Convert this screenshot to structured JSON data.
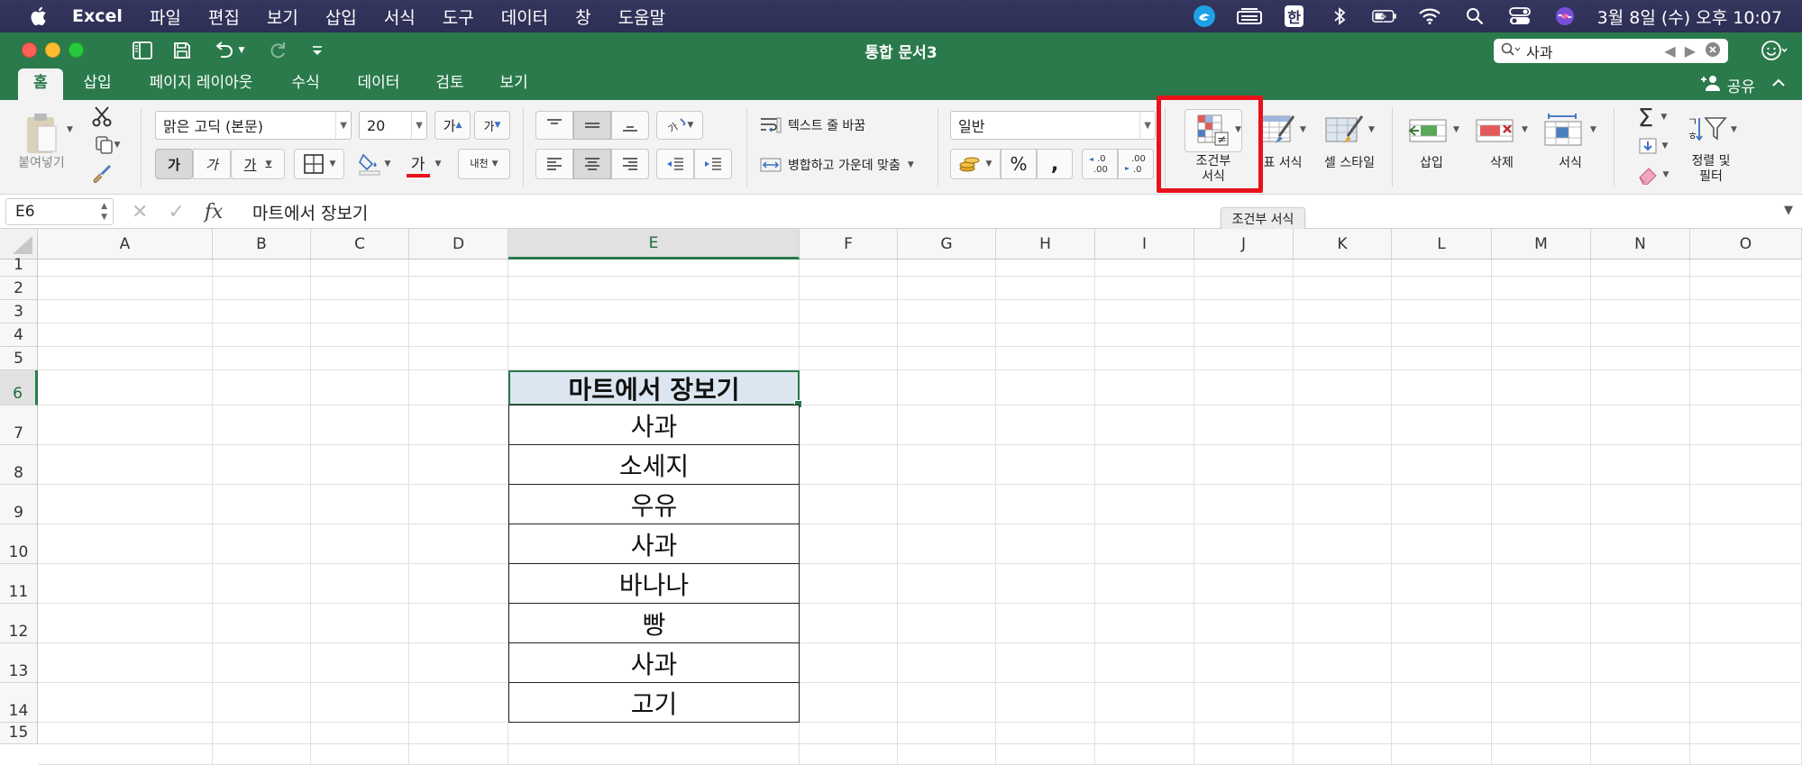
{
  "menubar": {
    "app_name": "Excel",
    "items": [
      "파일",
      "편집",
      "보기",
      "삽입",
      "서식",
      "도구",
      "데이터",
      "창",
      "도움말"
    ],
    "status_icons": [
      "app-status-icon",
      "keyboard-icon",
      "input-method-icon",
      "bluetooth-icon",
      "battery-icon",
      "wifi-icon",
      "search-icon",
      "control-center-icon",
      "siri-icon"
    ],
    "input_method": "한",
    "clock": "3월 8일 (수) 오후 10:07"
  },
  "window": {
    "title": "통합 문서3",
    "search_value": "사과"
  },
  "tabs": {
    "items": [
      "홈",
      "삽입",
      "페이지 레이아웃",
      "수식",
      "데이터",
      "검토",
      "보기"
    ],
    "active": "홈",
    "share_label": "공유"
  },
  "ribbon": {
    "paste_label": "붙여넣기",
    "font_name": "맑은 고딕 (본문)",
    "font_size": "20",
    "grow_label": "가",
    "shrink_label": "가",
    "bold_label": "가",
    "italic_label": "가",
    "underline_label": "가",
    "font_color_label": "가",
    "phonetic_label": "내천",
    "wrap_text_label": "텍스트 줄 바꿈",
    "merge_center_label": "병합하고 가운데 맞춤",
    "number_format": "일반",
    "percent_label": "%",
    "comma_label": ",",
    "conditional_format_label_1": "조건부",
    "conditional_format_label_2": "서식",
    "table_format_label": "표 서식",
    "cell_style_label": "셀 스타일",
    "insert_label": "삽입",
    "delete_label": "삭제",
    "format_label": "서식",
    "sort_filter_label_1": "정렬 및",
    "sort_filter_label_2": "필터",
    "accent_color": "#2a7a4b",
    "highlight_color": "#e8121a"
  },
  "tooltip": "조건부 서식",
  "formula_bar": {
    "name_box": "E6",
    "fx_label": "fx",
    "content": "마트에서 장보기"
  },
  "sheet": {
    "columns": [
      "A",
      "B",
      "C",
      "D",
      "E",
      "F",
      "G",
      "H",
      "I",
      "J",
      "K",
      "L",
      "M",
      "N",
      "O"
    ],
    "rows": [
      "1",
      "2",
      "3",
      "4",
      "5",
      "6",
      "7",
      "8",
      "9",
      "10",
      "11",
      "12",
      "13",
      "14",
      "15"
    ],
    "selected_cell": "E6",
    "list_header": "마트에서 장보기",
    "list_items": [
      "사과",
      "소세지",
      "우유",
      "사과",
      "바나나",
      "빵",
      "사과",
      "고기"
    ]
  }
}
